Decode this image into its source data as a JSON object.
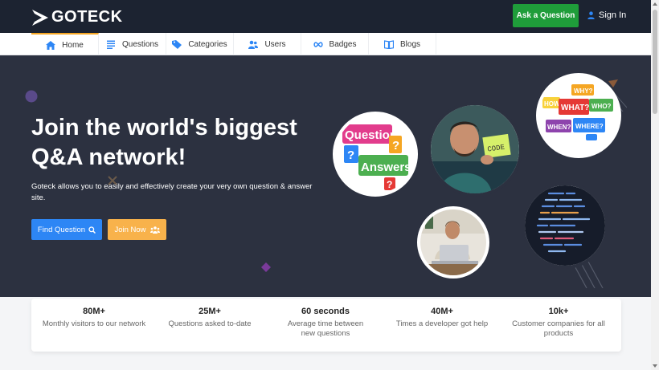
{
  "header": {
    "logo_text": "GOTECK",
    "ask_button": "Ask a Question",
    "signin": "Sign In"
  },
  "nav": {
    "items": [
      {
        "label": "Home",
        "icon": "home-icon",
        "active": true
      },
      {
        "label": "Questions",
        "icon": "list-icon",
        "active": false
      },
      {
        "label": "Categories",
        "icon": "tag-icon",
        "active": false
      },
      {
        "label": "Users",
        "icon": "users-icon",
        "active": false
      },
      {
        "label": "Badges",
        "icon": "infinity-icon",
        "active": false
      },
      {
        "label": "Blogs",
        "icon": "book-icon",
        "active": false
      }
    ]
  },
  "hero": {
    "title_line1": "Join the world's biggest",
    "title_line2": "Q&A network!",
    "description": "Goteck allows you to easily and effectively create your very own question & answer site.",
    "find_button": "Find Question",
    "join_button": "Join Now",
    "image_texts": {
      "questions": "Questions",
      "answers": "Answers",
      "code": "CODE",
      "why": "WHY?",
      "how": "HOW",
      "what": "WHAT?",
      "who": "WHO?",
      "when": "WHEN?",
      "where": "WHERE?"
    }
  },
  "stats": [
    {
      "value": "80M+",
      "label": "Monthly visitors to our network"
    },
    {
      "value": "25M+",
      "label": "Questions asked to-date"
    },
    {
      "value": "60 seconds",
      "label": "Average time between new questions"
    },
    {
      "value": "40M+",
      "label": "Times a developer got help"
    },
    {
      "value": "10k+",
      "label": "Customer companies for all products"
    }
  ],
  "colors": {
    "topbar": "#1c2331",
    "hero": "#2c3140",
    "ask_green": "#1f9d3a",
    "find_blue": "#2d86f5",
    "join_orange": "#f8b24b",
    "active_accent": "#f5a623",
    "icon_blue": "#2d86f5"
  }
}
